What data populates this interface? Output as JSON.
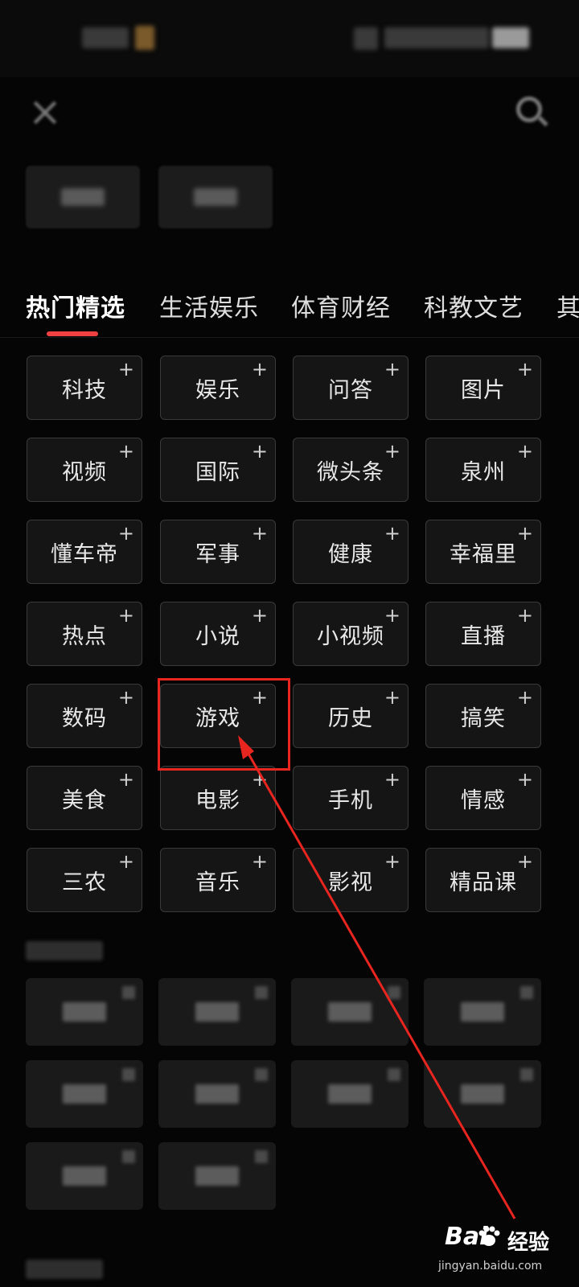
{
  "status_bar": {
    "time_text": "",
    "indicators_text": ""
  },
  "header": {
    "close_icon": "close-icon",
    "search_icon": "search-icon"
  },
  "tabs": [
    {
      "label": "热门精选",
      "active": true
    },
    {
      "label": "生活娱乐",
      "active": false
    },
    {
      "label": "体育财经",
      "active": false
    },
    {
      "label": "科教文艺",
      "active": false
    },
    {
      "label": "其",
      "active": false
    }
  ],
  "channels": [
    {
      "label": "科技"
    },
    {
      "label": "娱乐"
    },
    {
      "label": "问答"
    },
    {
      "label": "图片"
    },
    {
      "label": "视频"
    },
    {
      "label": "国际"
    },
    {
      "label": "微头条"
    },
    {
      "label": "泉州"
    },
    {
      "label": "懂车帝"
    },
    {
      "label": "军事"
    },
    {
      "label": "健康"
    },
    {
      "label": "幸福里"
    },
    {
      "label": "热点"
    },
    {
      "label": "小说"
    },
    {
      "label": "小视频"
    },
    {
      "label": "直播"
    },
    {
      "label": "数码"
    },
    {
      "label": "游戏",
      "highlighted": true
    },
    {
      "label": "历史"
    },
    {
      "label": "搞笑"
    },
    {
      "label": "美食"
    },
    {
      "label": "电影"
    },
    {
      "label": "手机"
    },
    {
      "label": "情感"
    },
    {
      "label": "三农"
    },
    {
      "label": "音乐"
    },
    {
      "label": "影视"
    },
    {
      "label": "精品课"
    }
  ],
  "plus_symbol": "+",
  "annotation": {
    "color": "#e8251f"
  },
  "accent_color": "#f04142",
  "watermark": {
    "brand": "Bai",
    "name": "经验",
    "url": "jingyan.baidu.com"
  }
}
